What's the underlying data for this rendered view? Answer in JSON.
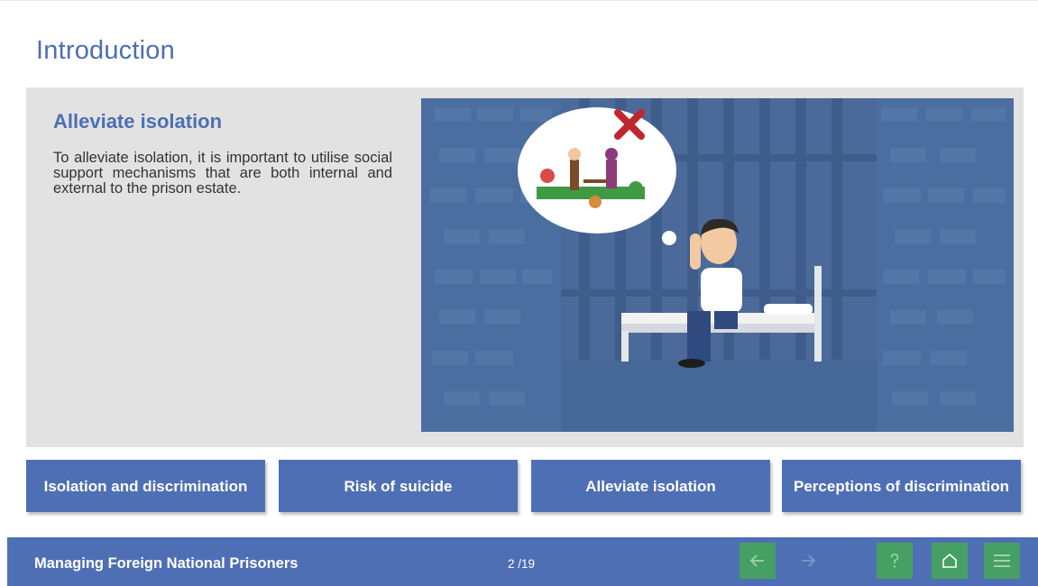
{
  "page": {
    "title": "Introduction"
  },
  "section": {
    "title": "Alleviate isolation",
    "body": "To alleviate isolation, it is important to utilise social support mechanisms that are both internal and external to the prison estate."
  },
  "tabs": [
    {
      "label": "Isolation and discrimination"
    },
    {
      "label": "Risk of suicide"
    },
    {
      "label": "Alleviate isolation"
    },
    {
      "label": "Perceptions of discrimination"
    }
  ],
  "footer": {
    "course_title": "Managing Foreign National Prisoners",
    "page_counter": "2 /19"
  },
  "icons": {
    "back": "arrow-left-icon",
    "next": "arrow-right-icon",
    "help": "question-icon",
    "home": "home-icon",
    "menu": "hamburger-menu-icon"
  },
  "colors": {
    "accent_blue": "#4f6fb5",
    "title_blue": "#4c6fb3",
    "nav_green": "#46a063",
    "panel_gray": "#e2e2e2"
  }
}
